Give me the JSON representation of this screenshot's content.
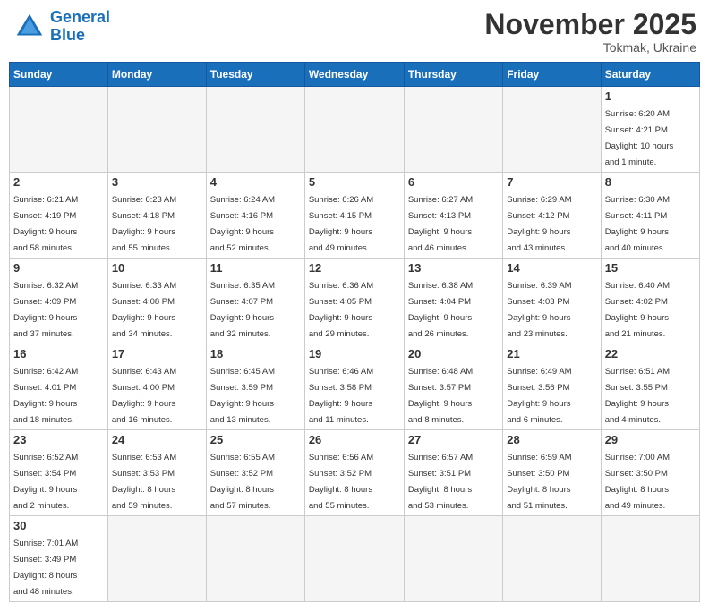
{
  "header": {
    "logo_general": "General",
    "logo_blue": "Blue",
    "month_title": "November 2025",
    "subtitle": "Tokmak, Ukraine"
  },
  "weekdays": [
    "Sunday",
    "Monday",
    "Tuesday",
    "Wednesday",
    "Thursday",
    "Friday",
    "Saturday"
  ],
  "days": {
    "d1": {
      "num": "1",
      "info": "Sunrise: 6:20 AM\nSunset: 4:21 PM\nDaylight: 10 hours\nand 1 minute."
    },
    "d2": {
      "num": "2",
      "info": "Sunrise: 6:21 AM\nSunset: 4:19 PM\nDaylight: 9 hours\nand 58 minutes."
    },
    "d3": {
      "num": "3",
      "info": "Sunrise: 6:23 AM\nSunset: 4:18 PM\nDaylight: 9 hours\nand 55 minutes."
    },
    "d4": {
      "num": "4",
      "info": "Sunrise: 6:24 AM\nSunset: 4:16 PM\nDaylight: 9 hours\nand 52 minutes."
    },
    "d5": {
      "num": "5",
      "info": "Sunrise: 6:26 AM\nSunset: 4:15 PM\nDaylight: 9 hours\nand 49 minutes."
    },
    "d6": {
      "num": "6",
      "info": "Sunrise: 6:27 AM\nSunset: 4:13 PM\nDaylight: 9 hours\nand 46 minutes."
    },
    "d7": {
      "num": "7",
      "info": "Sunrise: 6:29 AM\nSunset: 4:12 PM\nDaylight: 9 hours\nand 43 minutes."
    },
    "d8": {
      "num": "8",
      "info": "Sunrise: 6:30 AM\nSunset: 4:11 PM\nDaylight: 9 hours\nand 40 minutes."
    },
    "d9": {
      "num": "9",
      "info": "Sunrise: 6:32 AM\nSunset: 4:09 PM\nDaylight: 9 hours\nand 37 minutes."
    },
    "d10": {
      "num": "10",
      "info": "Sunrise: 6:33 AM\nSunset: 4:08 PM\nDaylight: 9 hours\nand 34 minutes."
    },
    "d11": {
      "num": "11",
      "info": "Sunrise: 6:35 AM\nSunset: 4:07 PM\nDaylight: 9 hours\nand 32 minutes."
    },
    "d12": {
      "num": "12",
      "info": "Sunrise: 6:36 AM\nSunset: 4:05 PM\nDaylight: 9 hours\nand 29 minutes."
    },
    "d13": {
      "num": "13",
      "info": "Sunrise: 6:38 AM\nSunset: 4:04 PM\nDaylight: 9 hours\nand 26 minutes."
    },
    "d14": {
      "num": "14",
      "info": "Sunrise: 6:39 AM\nSunset: 4:03 PM\nDaylight: 9 hours\nand 23 minutes."
    },
    "d15": {
      "num": "15",
      "info": "Sunrise: 6:40 AM\nSunset: 4:02 PM\nDaylight: 9 hours\nand 21 minutes."
    },
    "d16": {
      "num": "16",
      "info": "Sunrise: 6:42 AM\nSunset: 4:01 PM\nDaylight: 9 hours\nand 18 minutes."
    },
    "d17": {
      "num": "17",
      "info": "Sunrise: 6:43 AM\nSunset: 4:00 PM\nDaylight: 9 hours\nand 16 minutes."
    },
    "d18": {
      "num": "18",
      "info": "Sunrise: 6:45 AM\nSunset: 3:59 PM\nDaylight: 9 hours\nand 13 minutes."
    },
    "d19": {
      "num": "19",
      "info": "Sunrise: 6:46 AM\nSunset: 3:58 PM\nDaylight: 9 hours\nand 11 minutes."
    },
    "d20": {
      "num": "20",
      "info": "Sunrise: 6:48 AM\nSunset: 3:57 PM\nDaylight: 9 hours\nand 8 minutes."
    },
    "d21": {
      "num": "21",
      "info": "Sunrise: 6:49 AM\nSunset: 3:56 PM\nDaylight: 9 hours\nand 6 minutes."
    },
    "d22": {
      "num": "22",
      "info": "Sunrise: 6:51 AM\nSunset: 3:55 PM\nDaylight: 9 hours\nand 4 minutes."
    },
    "d23": {
      "num": "23",
      "info": "Sunrise: 6:52 AM\nSunset: 3:54 PM\nDaylight: 9 hours\nand 2 minutes."
    },
    "d24": {
      "num": "24",
      "info": "Sunrise: 6:53 AM\nSunset: 3:53 PM\nDaylight: 8 hours\nand 59 minutes."
    },
    "d25": {
      "num": "25",
      "info": "Sunrise: 6:55 AM\nSunset: 3:52 PM\nDaylight: 8 hours\nand 57 minutes."
    },
    "d26": {
      "num": "26",
      "info": "Sunrise: 6:56 AM\nSunset: 3:52 PM\nDaylight: 8 hours\nand 55 minutes."
    },
    "d27": {
      "num": "27",
      "info": "Sunrise: 6:57 AM\nSunset: 3:51 PM\nDaylight: 8 hours\nand 53 minutes."
    },
    "d28": {
      "num": "28",
      "info": "Sunrise: 6:59 AM\nSunset: 3:50 PM\nDaylight: 8 hours\nand 51 minutes."
    },
    "d29": {
      "num": "29",
      "info": "Sunrise: 7:00 AM\nSunset: 3:50 PM\nDaylight: 8 hours\nand 49 minutes."
    },
    "d30": {
      "num": "30",
      "info": "Sunrise: 7:01 AM\nSunset: 3:49 PM\nDaylight: 8 hours\nand 48 minutes."
    }
  }
}
